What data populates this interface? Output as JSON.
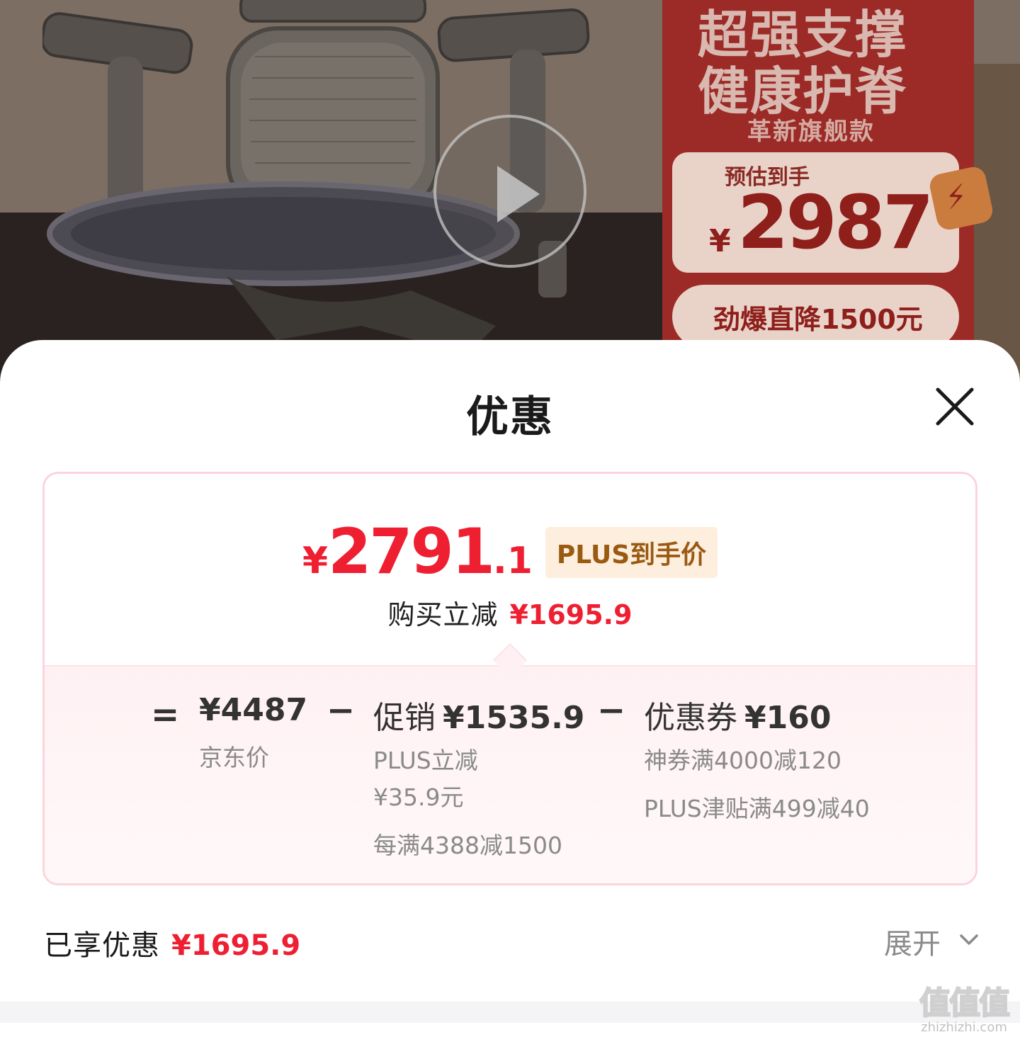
{
  "hero": {
    "play_icon": "play-icon",
    "promo": {
      "headline_1": "超强支撑",
      "headline_2": "健康护脊",
      "subtitle": "革新旗舰款",
      "price_label": "预估到手",
      "price_currency": "¥",
      "price_value": "2987",
      "deal_text": "劲爆直降1500元"
    }
  },
  "sheet": {
    "title": "优惠",
    "close_icon": "close-icon",
    "summary": {
      "currency": "¥",
      "price_int": "2791",
      "price_dec": ".1",
      "tag": "PLUS到手价",
      "reduce_label": "购买立减",
      "reduce_value": "¥1695.9"
    },
    "breakdown": {
      "op_equals": "=",
      "op_minus": "−",
      "jd_price": {
        "value": "¥4487",
        "label": "京东价"
      },
      "promo": {
        "label": "促销",
        "value": "¥1535.9",
        "lines": [
          "PLUS立减",
          "¥35.9元",
          "每满4388减1500"
        ]
      },
      "coupon": {
        "label": "优惠券",
        "value": "¥160",
        "lines": [
          "神券满4000减120",
          "PLUS津贴满499减40"
        ]
      }
    },
    "enjoyed": {
      "label": "已享优惠",
      "value": "¥1695.9"
    },
    "expand": {
      "label": "展开",
      "icon": "chevron-down-icon"
    }
  },
  "watermark": {
    "main": "值值值",
    "sub": "zhizhizhi.com"
  },
  "colors": {
    "accent_red": "#ef1f32",
    "card_border": "#fbd4dd",
    "plus_tag_bg": "#fdeedd",
    "plus_tag_text": "#9a5a12"
  }
}
